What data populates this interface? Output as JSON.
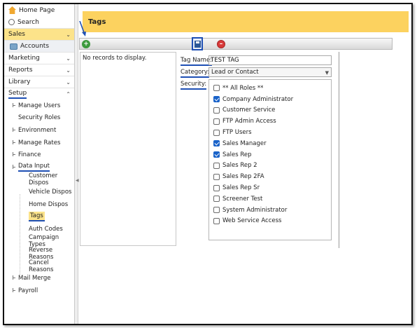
{
  "sidebar": {
    "home": "Home Page",
    "search": "Search",
    "sections": [
      {
        "label": "Sales"
      },
      {
        "label": "Accounts"
      },
      {
        "label": "Marketing"
      },
      {
        "label": "Reports"
      },
      {
        "label": "Library"
      },
      {
        "label": "Setup"
      }
    ],
    "setup_items": [
      "Manage Users",
      "Security Roles",
      "Environment",
      "Manage Rates",
      "Finance",
      "Data Input"
    ],
    "data_input_items": [
      "Customer Dispos",
      "Vehicle Dispos",
      "Home Dispos",
      "Tags",
      "Auth Codes",
      "Campaign Types",
      "Reverse Reasons",
      "Cancel Reasons"
    ],
    "bottom_items": [
      "Mail Merge",
      "Payroll"
    ]
  },
  "header": {
    "title": "Tags"
  },
  "list": {
    "empty_text": "No records to display."
  },
  "form": {
    "tag_name_label": "Tag Name:",
    "tag_name_value": "TEST TAG",
    "category_label": "Category:",
    "category_value": "Lead or Contact",
    "security_label": "Security:",
    "roles": [
      {
        "label": "** All Roles **",
        "checked": false
      },
      {
        "label": "Company Administrator",
        "checked": true
      },
      {
        "label": "Customer Service",
        "checked": false
      },
      {
        "label": "FTP Admin Access",
        "checked": false
      },
      {
        "label": "FTP Users",
        "checked": false
      },
      {
        "label": "Sales Manager",
        "checked": true
      },
      {
        "label": "Sales Rep",
        "checked": true
      },
      {
        "label": "Sales Rep 2",
        "checked": false
      },
      {
        "label": "Sales Rep 2FA",
        "checked": false
      },
      {
        "label": "Sales Rep Sr",
        "checked": false
      },
      {
        "label": "Screener Test",
        "checked": false
      },
      {
        "label": "System Administrator",
        "checked": false
      },
      {
        "label": "Web Service Access",
        "checked": false
      }
    ]
  },
  "colors": {
    "header_bg": "#fcd25f",
    "highlight_outline": "#1e4fb4",
    "checkbox_checked": "#1a63c9"
  },
  "icons": {
    "home": "home-icon",
    "search": "search-icon",
    "accounts": "accounts-icon",
    "add": "add-icon",
    "save": "save-icon",
    "cancel": "cancel-icon"
  }
}
